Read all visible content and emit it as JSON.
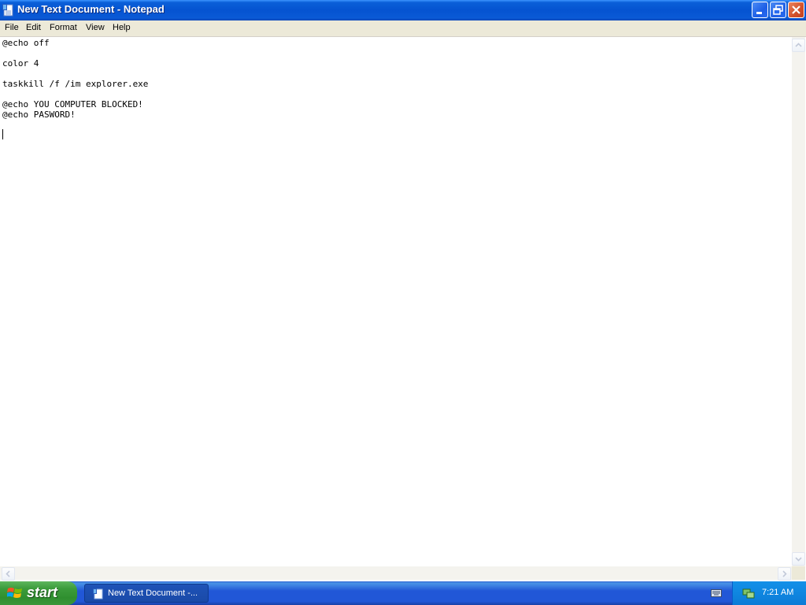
{
  "window": {
    "title": "New Text Document - Notepad",
    "icon": "notepad-icon"
  },
  "menu": {
    "items": [
      {
        "label": "File"
      },
      {
        "label": "Edit"
      },
      {
        "label": "Format"
      },
      {
        "label": "View"
      },
      {
        "label": "Help"
      }
    ]
  },
  "document": {
    "lines": [
      "@echo off",
      "color 4",
      "taskkill /f /im explorer.exe",
      "@echo YOU COMPUTER BLOCKED!",
      "@echo PASWORD!"
    ]
  },
  "taskbar": {
    "start_label": "start",
    "task_label": "New Text Document -...",
    "clock": "7:21 AM"
  },
  "colors": {
    "titlebar": "#0553d1",
    "menubar": "#ece9d8",
    "taskbar": "#2157d7",
    "start": "#3c9c3c",
    "close": "#d2502a"
  }
}
